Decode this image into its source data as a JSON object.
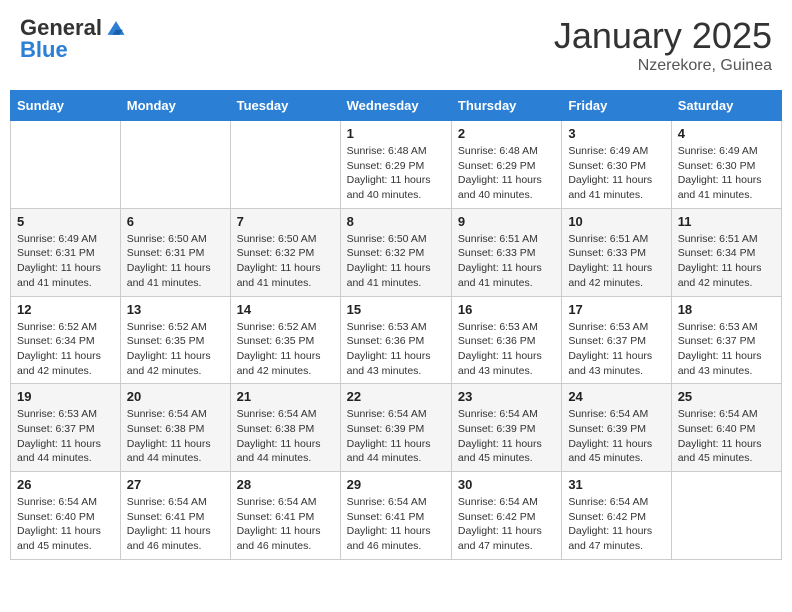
{
  "logo": {
    "general": "General",
    "blue": "Blue"
  },
  "title": "January 2025",
  "location": "Nzerekore, Guinea",
  "days_header": [
    "Sunday",
    "Monday",
    "Tuesday",
    "Wednesday",
    "Thursday",
    "Friday",
    "Saturday"
  ],
  "weeks": [
    [
      {
        "day": "",
        "info": ""
      },
      {
        "day": "",
        "info": ""
      },
      {
        "day": "",
        "info": ""
      },
      {
        "day": "1",
        "info": "Sunrise: 6:48 AM\nSunset: 6:29 PM\nDaylight: 11 hours and 40 minutes."
      },
      {
        "day": "2",
        "info": "Sunrise: 6:48 AM\nSunset: 6:29 PM\nDaylight: 11 hours and 40 minutes."
      },
      {
        "day": "3",
        "info": "Sunrise: 6:49 AM\nSunset: 6:30 PM\nDaylight: 11 hours and 41 minutes."
      },
      {
        "day": "4",
        "info": "Sunrise: 6:49 AM\nSunset: 6:30 PM\nDaylight: 11 hours and 41 minutes."
      }
    ],
    [
      {
        "day": "5",
        "info": "Sunrise: 6:49 AM\nSunset: 6:31 PM\nDaylight: 11 hours and 41 minutes."
      },
      {
        "day": "6",
        "info": "Sunrise: 6:50 AM\nSunset: 6:31 PM\nDaylight: 11 hours and 41 minutes."
      },
      {
        "day": "7",
        "info": "Sunrise: 6:50 AM\nSunset: 6:32 PM\nDaylight: 11 hours and 41 minutes."
      },
      {
        "day": "8",
        "info": "Sunrise: 6:50 AM\nSunset: 6:32 PM\nDaylight: 11 hours and 41 minutes."
      },
      {
        "day": "9",
        "info": "Sunrise: 6:51 AM\nSunset: 6:33 PM\nDaylight: 11 hours and 41 minutes."
      },
      {
        "day": "10",
        "info": "Sunrise: 6:51 AM\nSunset: 6:33 PM\nDaylight: 11 hours and 42 minutes."
      },
      {
        "day": "11",
        "info": "Sunrise: 6:51 AM\nSunset: 6:34 PM\nDaylight: 11 hours and 42 minutes."
      }
    ],
    [
      {
        "day": "12",
        "info": "Sunrise: 6:52 AM\nSunset: 6:34 PM\nDaylight: 11 hours and 42 minutes."
      },
      {
        "day": "13",
        "info": "Sunrise: 6:52 AM\nSunset: 6:35 PM\nDaylight: 11 hours and 42 minutes."
      },
      {
        "day": "14",
        "info": "Sunrise: 6:52 AM\nSunset: 6:35 PM\nDaylight: 11 hours and 42 minutes."
      },
      {
        "day": "15",
        "info": "Sunrise: 6:53 AM\nSunset: 6:36 PM\nDaylight: 11 hours and 43 minutes."
      },
      {
        "day": "16",
        "info": "Sunrise: 6:53 AM\nSunset: 6:36 PM\nDaylight: 11 hours and 43 minutes."
      },
      {
        "day": "17",
        "info": "Sunrise: 6:53 AM\nSunset: 6:37 PM\nDaylight: 11 hours and 43 minutes."
      },
      {
        "day": "18",
        "info": "Sunrise: 6:53 AM\nSunset: 6:37 PM\nDaylight: 11 hours and 43 minutes."
      }
    ],
    [
      {
        "day": "19",
        "info": "Sunrise: 6:53 AM\nSunset: 6:37 PM\nDaylight: 11 hours and 44 minutes."
      },
      {
        "day": "20",
        "info": "Sunrise: 6:54 AM\nSunset: 6:38 PM\nDaylight: 11 hours and 44 minutes."
      },
      {
        "day": "21",
        "info": "Sunrise: 6:54 AM\nSunset: 6:38 PM\nDaylight: 11 hours and 44 minutes."
      },
      {
        "day": "22",
        "info": "Sunrise: 6:54 AM\nSunset: 6:39 PM\nDaylight: 11 hours and 44 minutes."
      },
      {
        "day": "23",
        "info": "Sunrise: 6:54 AM\nSunset: 6:39 PM\nDaylight: 11 hours and 45 minutes."
      },
      {
        "day": "24",
        "info": "Sunrise: 6:54 AM\nSunset: 6:39 PM\nDaylight: 11 hours and 45 minutes."
      },
      {
        "day": "25",
        "info": "Sunrise: 6:54 AM\nSunset: 6:40 PM\nDaylight: 11 hours and 45 minutes."
      }
    ],
    [
      {
        "day": "26",
        "info": "Sunrise: 6:54 AM\nSunset: 6:40 PM\nDaylight: 11 hours and 45 minutes."
      },
      {
        "day": "27",
        "info": "Sunrise: 6:54 AM\nSunset: 6:41 PM\nDaylight: 11 hours and 46 minutes."
      },
      {
        "day": "28",
        "info": "Sunrise: 6:54 AM\nSunset: 6:41 PM\nDaylight: 11 hours and 46 minutes."
      },
      {
        "day": "29",
        "info": "Sunrise: 6:54 AM\nSunset: 6:41 PM\nDaylight: 11 hours and 46 minutes."
      },
      {
        "day": "30",
        "info": "Sunrise: 6:54 AM\nSunset: 6:42 PM\nDaylight: 11 hours and 47 minutes."
      },
      {
        "day": "31",
        "info": "Sunrise: 6:54 AM\nSunset: 6:42 PM\nDaylight: 11 hours and 47 minutes."
      },
      {
        "day": "",
        "info": ""
      }
    ]
  ]
}
